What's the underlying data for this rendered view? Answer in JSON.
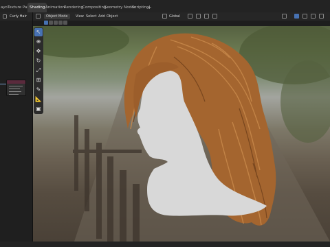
{
  "workspace_tabs": [
    "ayo",
    "Texture Paint",
    "Shading",
    "Animation",
    "Rendering",
    "Compositing",
    "Geometry Nodes",
    "Scripting"
  ],
  "add_workspace": "+",
  "left_panel": {
    "title": "Curly Hair"
  },
  "viewport_header": {
    "mode": "Object Mode",
    "menus": [
      "View",
      "Select",
      "Add",
      "Object"
    ],
    "orientation": "Global"
  },
  "tools": [
    {
      "name": "select-box",
      "glyph": "↖"
    },
    {
      "name": "cursor",
      "glyph": "⊕"
    },
    {
      "name": "move",
      "glyph": "✥"
    },
    {
      "name": "rotate",
      "glyph": "↻"
    },
    {
      "name": "scale",
      "glyph": "⤢"
    },
    {
      "name": "transform",
      "glyph": "⊞"
    },
    {
      "name": "annotate",
      "glyph": "✎"
    },
    {
      "name": "measure",
      "glyph": "📐"
    },
    {
      "name": "add-cube",
      "glyph": "▣"
    }
  ],
  "colors": {
    "accent": "#4772b3",
    "hair": "#a4652f",
    "head": "#d8d8d8",
    "node_header": "#5a2a3c"
  }
}
